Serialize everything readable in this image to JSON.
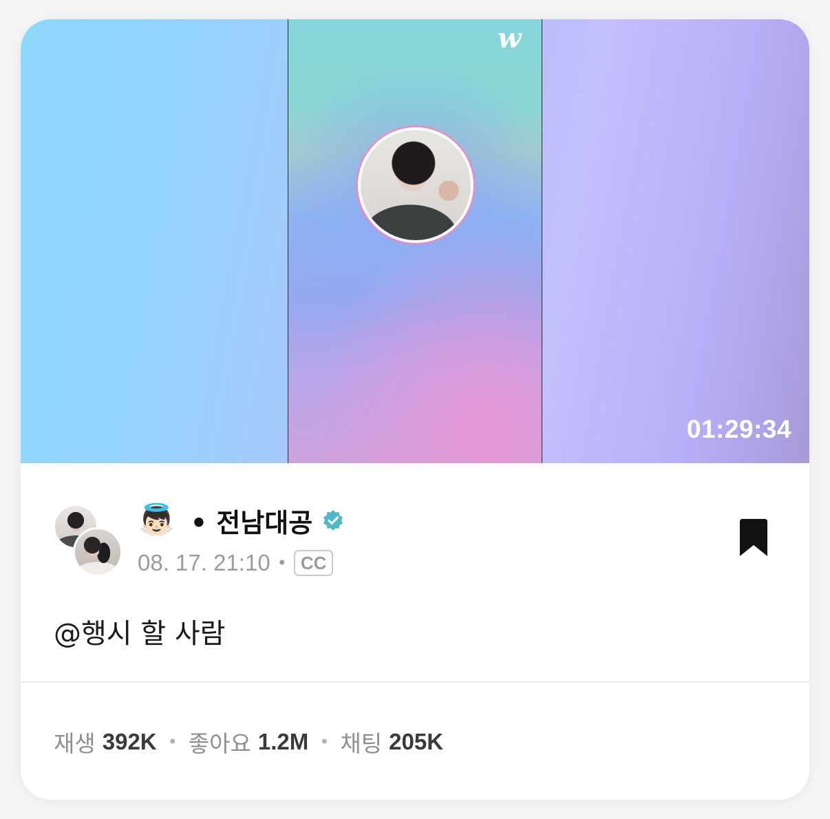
{
  "video": {
    "duration": "01:29:34",
    "brand_mark": "w",
    "colors": {
      "left_bg": "#8ed8fb",
      "right_bg": "#b7aff7",
      "center_top": "#84d6da",
      "center_bottom": "#cca2dc"
    }
  },
  "post": {
    "author_emoji": "👼🏻",
    "author_name": "• 전남대공",
    "verified_icon": "verified-badge-icon",
    "date": "08. 17. 21:10",
    "separator": "•",
    "cc_label": "CC",
    "caption": "@행시 할 사람",
    "bookmark_icon": "bookmark-icon"
  },
  "stats": [
    {
      "label": "재생",
      "value": "392K"
    },
    {
      "label": "좋아요",
      "value": "1.2M"
    },
    {
      "label": "채팅",
      "value": "205K"
    }
  ],
  "stat_separator": "•",
  "colors": {
    "verified": "#4fb7c7",
    "text_primary": "#111111",
    "text_secondary": "#9a9aa0"
  }
}
